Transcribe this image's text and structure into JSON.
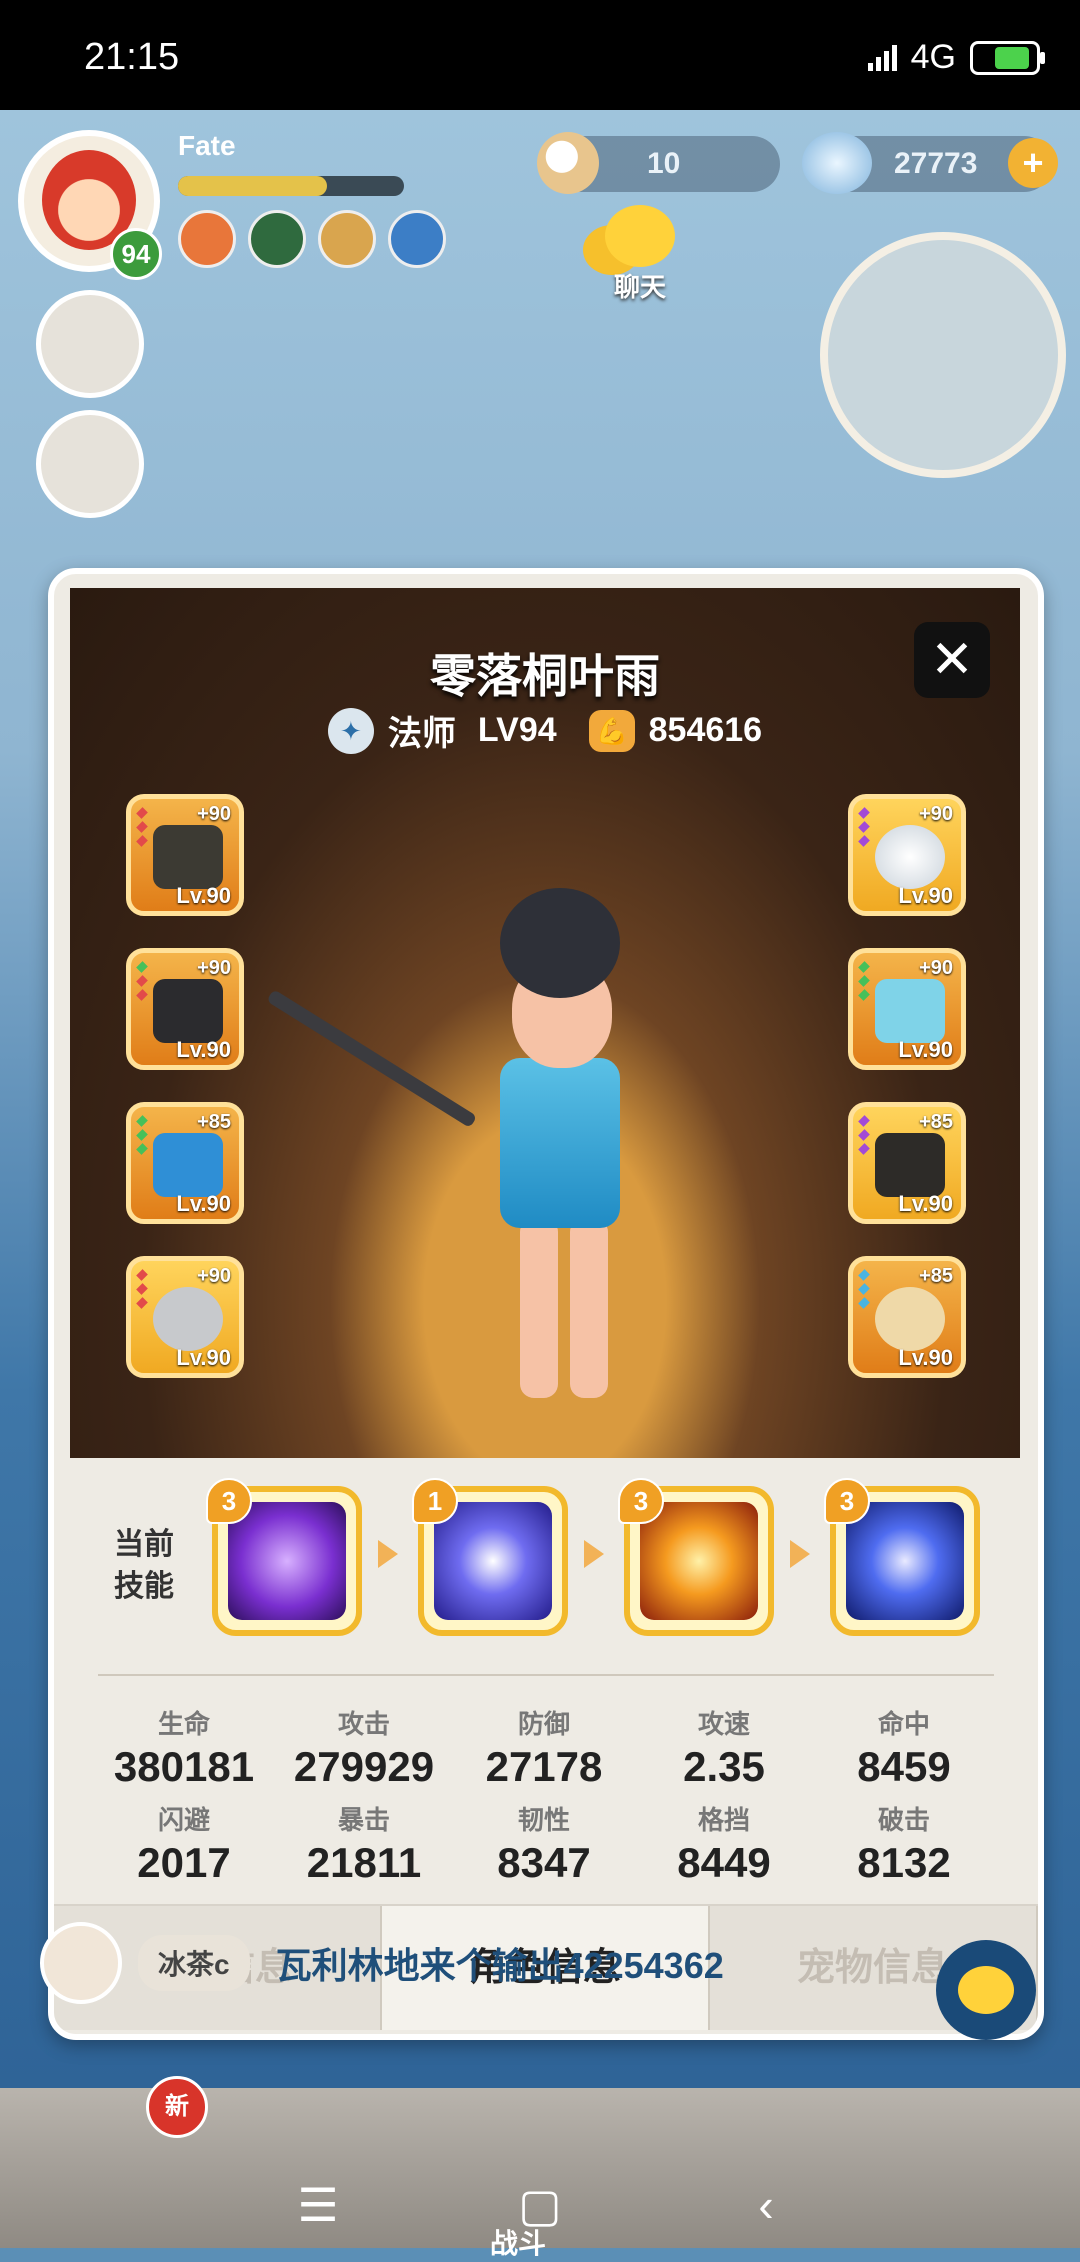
{
  "status_bar": {
    "time": "21:15",
    "network": "4G"
  },
  "player": {
    "name": "Fate",
    "level": "94",
    "xp_fraction": 0.66
  },
  "resources": {
    "pearls": "10",
    "gems": "27773"
  },
  "chat_button": {
    "label": "聊天"
  },
  "character": {
    "name": "零落桐叶雨",
    "class": "法师",
    "level": "LV94",
    "power": "854616"
  },
  "equipment": {
    "left": [
      {
        "plus": "+90",
        "lv": "Lv.90"
      },
      {
        "plus": "+90",
        "lv": "Lv.90"
      },
      {
        "plus": "+85",
        "lv": "Lv.90"
      },
      {
        "plus": "+90",
        "lv": "Lv.90"
      }
    ],
    "right": [
      {
        "plus": "+90",
        "lv": "Lv.90"
      },
      {
        "plus": "+90",
        "lv": "Lv.90"
      },
      {
        "plus": "+85",
        "lv": "Lv.90"
      },
      {
        "plus": "+85",
        "lv": "Lv.90"
      }
    ]
  },
  "skills": {
    "label_line1": "当前",
    "label_line2": "技能",
    "items": [
      {
        "badge": "3",
        "color": "#7a2fd0"
      },
      {
        "badge": "1",
        "color": "#3b38c8"
      },
      {
        "badge": "3",
        "color": "#e46a12"
      },
      {
        "badge": "3",
        "color": "#2c4fd8"
      }
    ]
  },
  "stats": [
    {
      "label": "生命",
      "value": "380181"
    },
    {
      "label": "攻击",
      "value": "279929"
    },
    {
      "label": "防御",
      "value": "27178"
    },
    {
      "label": "攻速",
      "value": "2.35"
    },
    {
      "label": "命中",
      "value": "8459"
    },
    {
      "label": "闪避",
      "value": "2017"
    },
    {
      "label": "暴击",
      "value": "21811"
    },
    {
      "label": "韧性",
      "value": "8347"
    },
    {
      "label": "格挡",
      "value": "8449"
    },
    {
      "label": "破击",
      "value": "8132"
    }
  ],
  "tabs": {
    "player_info": "玩家信息",
    "character_info": "角色信息",
    "pet_info": "宠物信息"
  },
  "chat": {
    "nickname": "冰茶c",
    "message": "瓦利林地来个输出42254362"
  },
  "bottom": {
    "new_badge": "新",
    "fight_label": "战斗"
  },
  "colors": {
    "accent": "#f2b92c",
    "modal_bg": "#eeebe4"
  }
}
